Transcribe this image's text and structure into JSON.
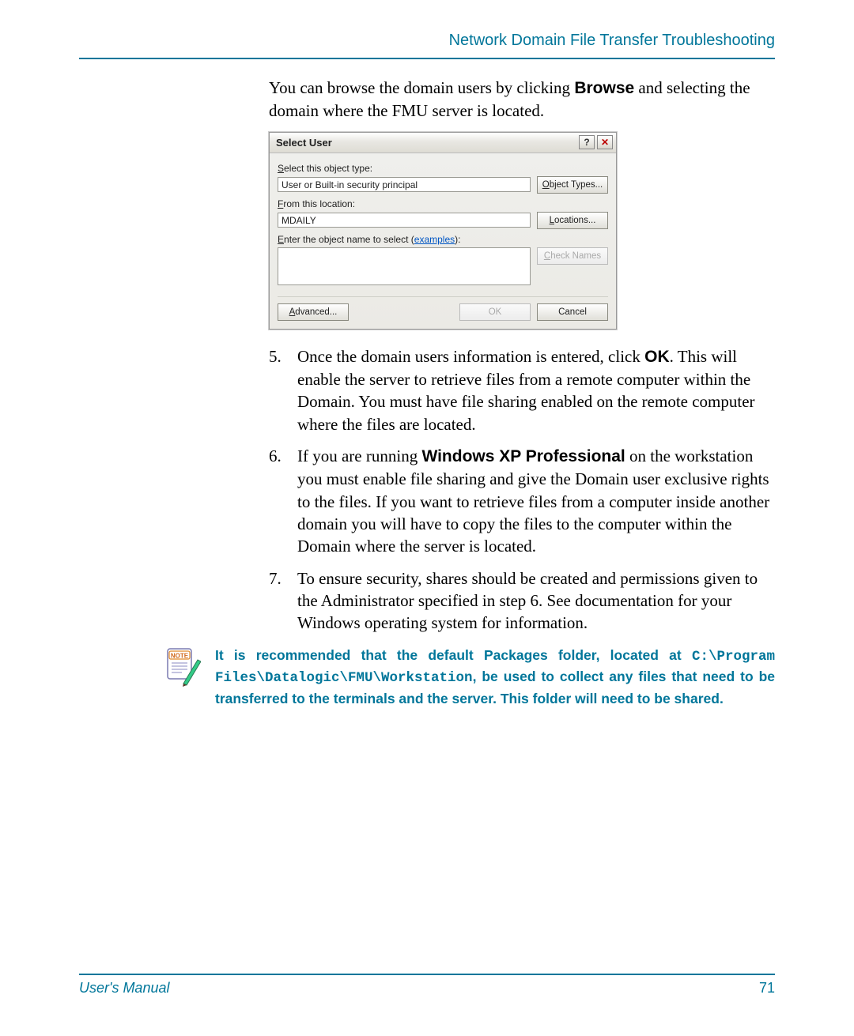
{
  "header": {
    "title": "Network Domain File Transfer Troubleshooting"
  },
  "intro": {
    "prefix": "You can browse the domain users by clicking ",
    "bold": "Browse",
    "suffix": " and selecting the domain where the FMU server is located."
  },
  "dialog": {
    "title": "Select User",
    "help_btn": "?",
    "close_btn": "✕",
    "object_type_label_pre": "S",
    "object_type_label_rest": "elect this object type:",
    "object_type_value": "User or Built-in security principal",
    "object_types_btn_ul": "O",
    "object_types_btn_rest": "bject Types...",
    "from_location_label_ul": "F",
    "from_location_label_rest": "rom this location:",
    "from_location_value": "MDAILY",
    "locations_btn_ul": "L",
    "locations_btn_rest": "ocations...",
    "enter_name_label_ul": "E",
    "enter_name_label_rest": "nter the object name to select (",
    "examples_link": "examples",
    "enter_name_label_end": "):",
    "check_names_btn_ul": "C",
    "check_names_btn_rest": "heck Names",
    "advanced_btn_ul": "A",
    "advanced_btn_rest": "dvanced...",
    "ok_btn": "OK",
    "cancel_btn": "Cancel"
  },
  "steps": [
    {
      "num": "5.",
      "segments": [
        {
          "t": "Once the domain users information is entered, click "
        },
        {
          "t": "OK",
          "bold": true,
          "sans": true
        },
        {
          "t": ". This will enable the server to retrieve files from a remote computer within the Domain. You must have file sharing enabled on the remote computer where the files are located."
        }
      ]
    },
    {
      "num": "6.",
      "segments": [
        {
          "t": "If you are running "
        },
        {
          "t": "Windows XP Professional",
          "bold": true,
          "sans": true
        },
        {
          "t": " on the workstation you must enable file sharing and give the Domain user exclusive rights to the files. If you want to retrieve files from a computer inside another domain you will have to copy the files to the computer within the Domain where the server is located."
        }
      ]
    },
    {
      "num": "7.",
      "segments": [
        {
          "t": "To ensure security, shares should be created and permissions given to the Administrator specified in step 6. See documentation for your Windows operating system for information."
        }
      ]
    }
  ],
  "note": {
    "segments": [
      {
        "t": "It is recommended that the default Packages folder, located at "
      },
      {
        "t": "C:\\Program Files\\Datalogic\\FMU\\Workstation",
        "mono": true
      },
      {
        "t": ", be used to collect any files that need to be transferred to the terminals and the server. This folder will need to be shared."
      }
    ]
  },
  "footer": {
    "left": "User's Manual",
    "right": "71"
  }
}
